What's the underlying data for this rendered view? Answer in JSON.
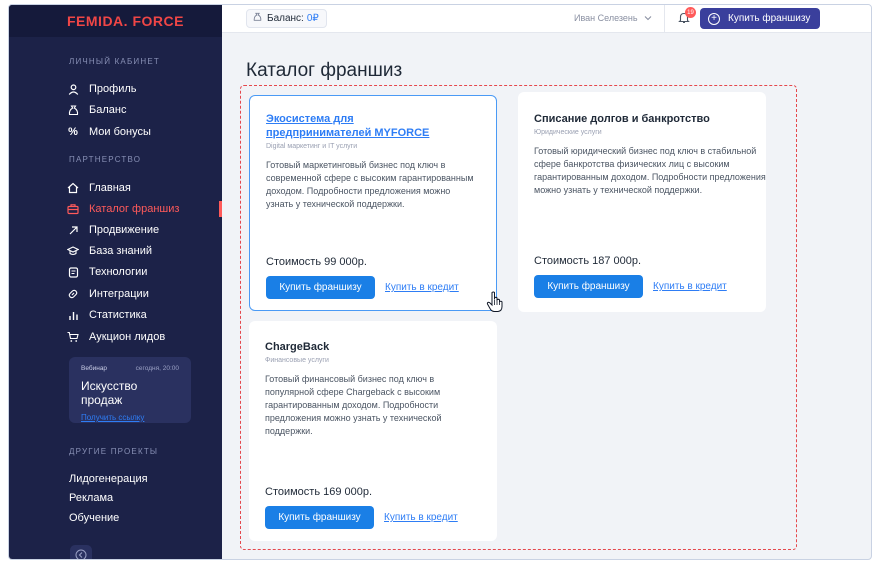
{
  "brand": {
    "logo": "FEMIDA. FORCE"
  },
  "header": {
    "balance_label": "Баланс:",
    "balance_value": "0₽",
    "user_name": "Иван Селезень",
    "notifications_count": "19",
    "buy_button": "Купить франшизу"
  },
  "sidebar": {
    "cabinet_title": "ЛИЧНЫЙ КАБИНЕТ",
    "cabinet_items": [
      {
        "label": "Профиль",
        "icon": "user-icon"
      },
      {
        "label": "Баланс",
        "icon": "money-bag-icon"
      },
      {
        "label": "Мои бонусы",
        "icon": "percent-icon"
      }
    ],
    "partner_title": "ПАРТНЕРСТВО",
    "partner_items": [
      {
        "label": "Главная",
        "icon": "home-icon"
      },
      {
        "label": "Каталог франшиз",
        "icon": "briefcase-icon",
        "active": true
      },
      {
        "label": "Продвижение",
        "icon": "arrow-up-right-icon"
      },
      {
        "label": "База знаний",
        "icon": "graduation-cap-icon"
      },
      {
        "label": "Технологии",
        "icon": "document-icon"
      },
      {
        "label": "Интеграции",
        "icon": "link-icon"
      },
      {
        "label": "Статистика",
        "icon": "bar-chart-icon"
      },
      {
        "label": "Аукцион лидов",
        "icon": "cart-icon"
      }
    ],
    "webinar": {
      "tag": "Вебинар",
      "time": "сегодня, 20:00",
      "title": "Искусство продаж",
      "link": "Получить ссылку"
    },
    "other_title": "ДРУГИЕ ПРОЕКТЫ",
    "other_items": [
      "Лидогенерация",
      "Реклама",
      "Обучение"
    ]
  },
  "main": {
    "title": "Каталог франшиз",
    "cards": [
      {
        "title": "Экосистема для предпринимателей MYFORCE",
        "category": "Digital маркетинг и IT услуги",
        "description": "Готовый маркетинговый бизнес под ключ в современной сфере с высоким гарантированным доходом. Подробности предложения можно узнать у технической поддержки.",
        "price": "Стоимость 99 000р.",
        "buy": "Купить франшизу",
        "credit": "Купить в кредит"
      },
      {
        "title": "Списание долгов и банкротство",
        "category": "Юридические услуги",
        "description": "Готовый юридический бизнес под ключ в стабильной сфере банкротства физических лиц с высоким гарантированным доходом. Подробности предложения можно узнать у технической поддержки.",
        "price": "Стоимость 187 000р.",
        "buy": "Купить франшизу",
        "credit": "Купить в кредит"
      },
      {
        "title": "ChargeBack",
        "category": "Финансовые услуги",
        "description": "Готовый финансовый бизнес под ключ в популярной сфере Chargeback с высоким гарантированным доходом. Подробности предложения можно узнать у технической поддержки.",
        "price": "Стоимость 169 000р.",
        "buy": "Купить франшизу",
        "credit": "Купить в кредит"
      }
    ]
  },
  "colors": {
    "sidebar_bg": "#1c2248",
    "brand_red": "#f04646",
    "accent_blue": "#1a7fe6",
    "header_button": "#3a3f9c",
    "highlight_border": "#e5484d"
  }
}
